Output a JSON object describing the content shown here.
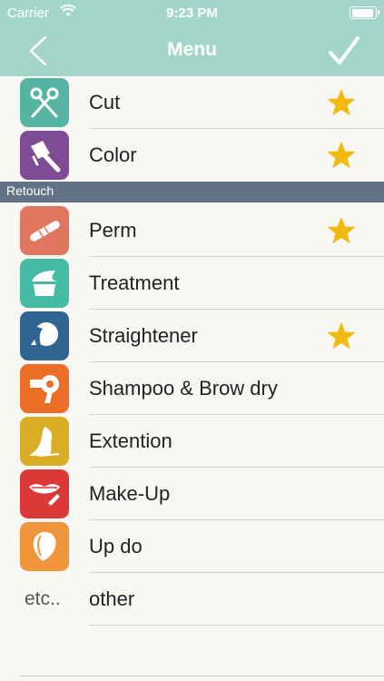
{
  "status": {
    "carrier": "Carrier",
    "time": "9:23 PM"
  },
  "nav": {
    "title": "Menu",
    "back": "back-chevron-icon",
    "done": "checkmark-icon"
  },
  "colors": {
    "header": "#a3d6c9",
    "section": "#627387",
    "star": "#f2b90f",
    "cut": "#55b4a2",
    "color": "#7e4c94",
    "perm": "#e1765f",
    "treatment": "#45bba3",
    "straightener": "#2f6590",
    "shampoo": "#ec6d26",
    "extention": "#d9ad24",
    "makeup": "#db3837",
    "updo": "#f0953c"
  },
  "menu": {
    "top_items": [
      {
        "label": "Cut",
        "icon": "scissors-icon",
        "starred": true
      },
      {
        "label": "Color",
        "icon": "dye-brush-icon",
        "starred": true
      }
    ],
    "section_label": "Retouch",
    "section_items": [
      {
        "label": "Perm",
        "icon": "perm-curler-icon",
        "starred": true
      },
      {
        "label": "Treatment",
        "icon": "treatment-cream-icon",
        "starred": false
      },
      {
        "label": "Straightener",
        "icon": "straight-hair-head-icon",
        "starred": true
      },
      {
        "label": "Shampoo & Brow dry",
        "icon": "hair-dryer-icon",
        "starred": false
      },
      {
        "label": "Extention",
        "icon": "hair-extension-icon",
        "starred": false
      },
      {
        "label": "Make-Up",
        "icon": "lipstick-icon",
        "starred": false
      },
      {
        "label": "Up do",
        "icon": "updo-head-icon",
        "starred": false
      },
      {
        "label": "other",
        "icon_text": "etc..",
        "starred": false
      }
    ]
  }
}
